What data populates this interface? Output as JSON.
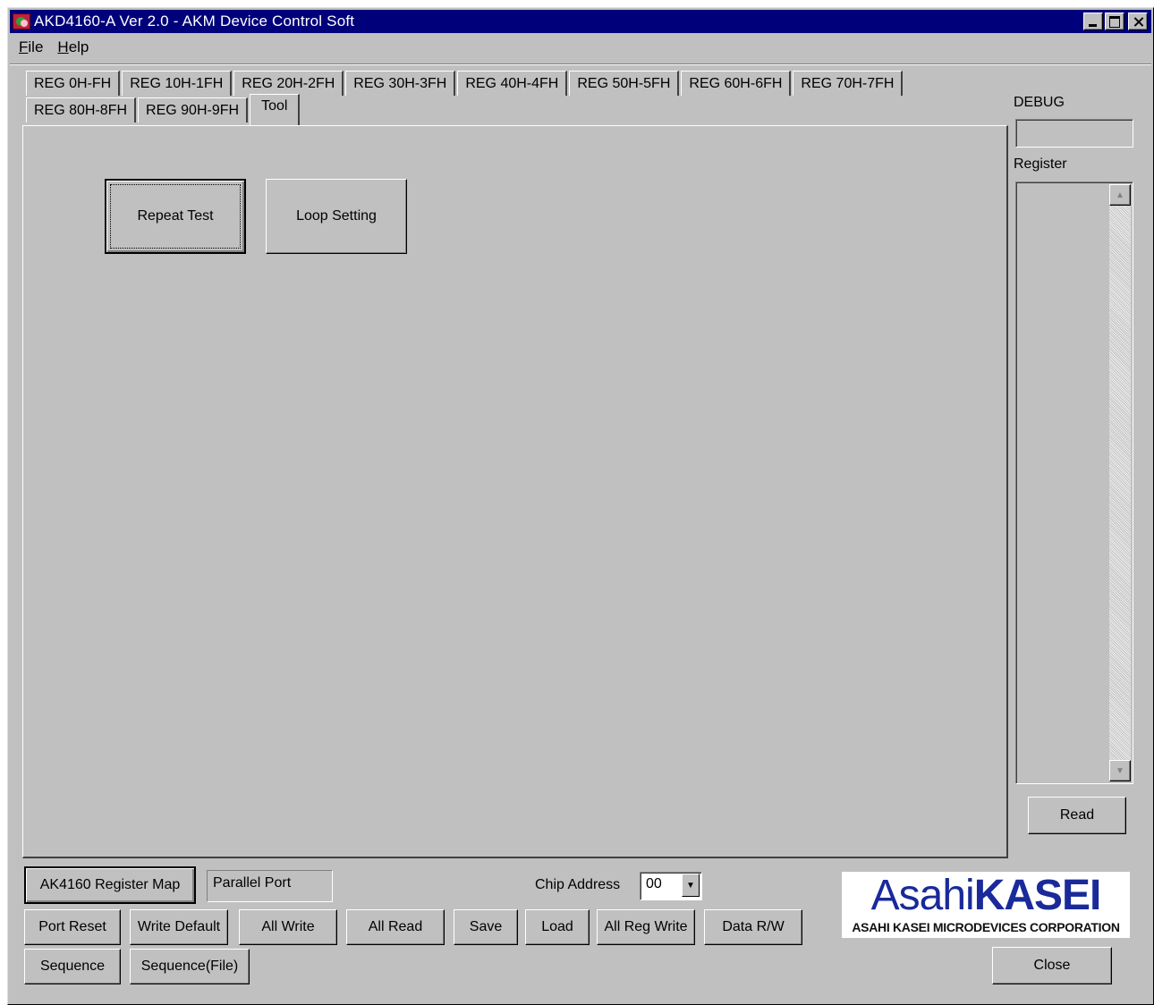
{
  "window": {
    "title": "AKD4160-A Ver 2.0 - AKM Device Control Soft"
  },
  "menu": {
    "file": "File",
    "file_hotkey": "F",
    "file_rest": "ile",
    "help_hotkey": "H",
    "help_rest": "elp"
  },
  "tabs": {
    "row1": [
      "REG 0H-FH",
      "REG 10H-1FH",
      "REG 20H-2FH",
      "REG 30H-3FH",
      "REG 40H-4FH",
      "REG 50H-5FH",
      "REG 60H-6FH",
      "REG 70H-7FH"
    ],
    "row2": [
      "REG 80H-8FH",
      "REG 90H-9FH",
      "Tool"
    ],
    "active": "Tool"
  },
  "tool": {
    "repeat_test": "Repeat Test",
    "loop_setting": "Loop Setting"
  },
  "side": {
    "debug_label": "DEBUG",
    "debug_value": "",
    "register_label": "Register",
    "read_button": "Read"
  },
  "bottom": {
    "register_map": "AK4160 Register Map",
    "port_display": "Parallel Port",
    "chip_address_label": "Chip Address",
    "chip_address_value": "00",
    "port_reset": "Port Reset",
    "write_default": "Write Default",
    "all_write": "All Write",
    "all_read": "All Read",
    "save": "Save",
    "load": "Load",
    "all_reg_write": "All Reg Write",
    "data_rw": "Data R/W",
    "sequence": "Sequence",
    "sequence_file": "Sequence(File)",
    "close": "Close"
  },
  "logo": {
    "asahi": "Asahi",
    "kasei": "KASEI",
    "subtitle": "ASAHI KASEI MICRODEVICES CORPORATION",
    "color": "#1a2a9a"
  }
}
